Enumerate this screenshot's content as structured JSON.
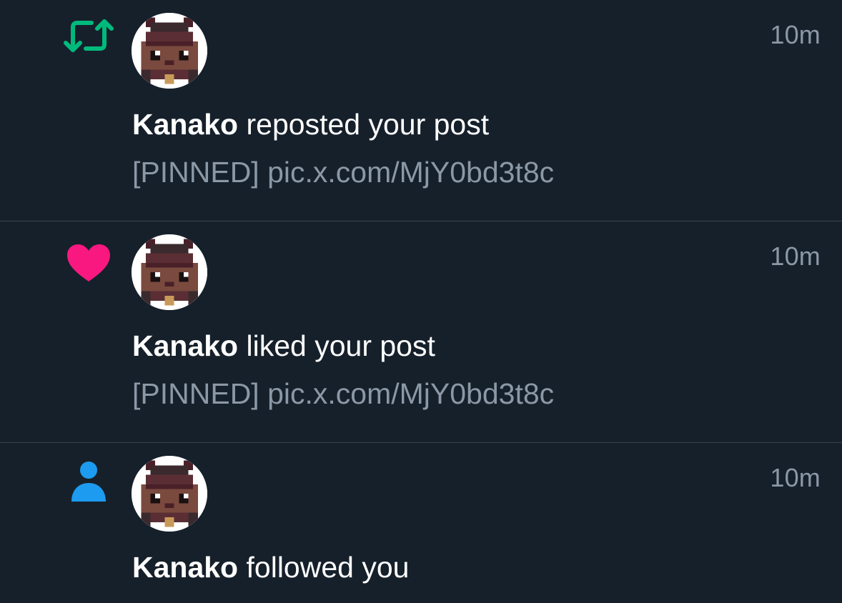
{
  "notifications": [
    {
      "type_icon": "repost-icon",
      "icon_color": "#00ba7c",
      "time": "10m",
      "user": "Kanako",
      "action": "reposted your post",
      "snippet": "[PINNED] pic.x.com/MjY0bd3t8c"
    },
    {
      "type_icon": "heart-icon",
      "icon_color": "#f91880",
      "time": "10m",
      "user": "Kanako",
      "action": "liked your post",
      "snippet": "[PINNED] pic.x.com/MjY0bd3t8c"
    },
    {
      "type_icon": "person-icon",
      "icon_color": "#1d9bf0",
      "time": "10m",
      "user": "Kanako",
      "action": "followed you"
    }
  ],
  "colors": {
    "background": "#16202b",
    "divider": "#38444d",
    "primary_text": "#ffffff",
    "secondary_text": "#8b98a5"
  }
}
